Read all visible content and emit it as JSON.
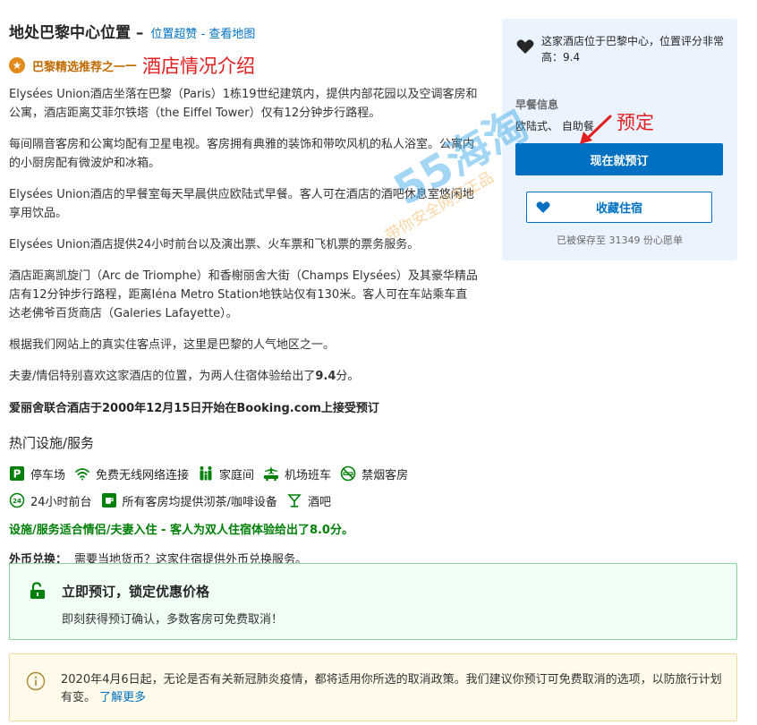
{
  "header": {
    "title": "地处巴黎中心位置 –",
    "link_location": "位置超赞",
    "separator": " - ",
    "link_map": "查看地图"
  },
  "recommendation": {
    "label": "巴黎精选推荐之一",
    "annotation": "酒店情况介绍"
  },
  "description": [
    "Elysées Union酒店坐落在巴黎（Paris）1栋19世纪建筑内，提供内部花园以及空调客房和公寓，酒店距离艾菲尔铁塔（the Eiffel Tower）仅有12分钟步行路程。",
    "每间隔音客房和公寓均配有卫星电视。客房拥有典雅的装饰和带吹风机的私人浴室。公寓内的小厨房配有微波炉和冰箱。",
    "Elysées Union酒店的早餐室每天早晨供应欧陆式早餐。客人可在酒店的酒吧休息室悠闲地享用饮品。",
    "Elysées Union酒店提供24小时前台以及演出票、火车票和飞机票的票务服务。",
    "酒店距离凯旋门（Arc de Triomphe）和香榭丽舍大街（Champs Elysées）及其豪华精品店有12分钟步行路程，距离Iéna Metro Station地铁站仅有130米。客人可在车站乘车直达老佛爷百货商店（Galeries Lafayette）。",
    "根据我们网站上的真实住客点评，这里是巴黎的人气地区之一。"
  ],
  "couple_rating_text": {
    "prefix": "夫妻/情侣特别喜欢这家酒店的位置，为两人住宿体验给出了",
    "score": "9.4",
    "suffix": "分。"
  },
  "founded": "爱丽舍联合酒店于2000年12月15日开始在Booking.com上接受预订",
  "facilities": {
    "heading": "热门设施/服务",
    "row1": [
      "停车场",
      "免费无线网络连接",
      "家庭间",
      "机场班车",
      "禁烟客房"
    ],
    "row2": [
      "24小时前台",
      "所有客房均提供沏茶/咖啡设备",
      "酒吧"
    ],
    "icon_names": [
      "parking-icon",
      "wifi-icon",
      "family-icon",
      "shuttle-icon",
      "no-smoking-icon",
      "24h-icon",
      "coffee-icon",
      "bar-icon"
    ]
  },
  "couple_suitable": "设施/服务适合情侣/夫妻入住 - 客人为双人住宿体验给出了8.0分。",
  "currency": {
    "label": "外币兑换：",
    "text": "需要当地货币？这家住宿提供外币兑换服务。"
  },
  "book_now_box": {
    "title": "立即预订，锁定优惠价格",
    "subtitle": "即刻获得预订确认，多数客房可免费取消！"
  },
  "notice": {
    "text": "2020年4月6日起，无论是否有关新冠肺炎疫情，都将适用你所选的取消政策。我们建议你预订可免费取消的选项，以防旅行计划有变。",
    "link": "了解更多"
  },
  "sidebar": {
    "location_text": "这家酒店位于巴黎中心，位置评分非常高：9.4",
    "breakfast_label": "早餐信息",
    "breakfast_value": "欧陆式、 自助餐",
    "annotation": "预定",
    "reserve_button": "现在就预订",
    "save_button": "收藏住宿",
    "saved_count": "已被保存至 31349 份心愿单"
  },
  "watermark": {
    "brand": "55海淘",
    "slogan": "带你安全网买正品"
  },
  "colors": {
    "primary_blue": "#0071c2",
    "green": "#008009",
    "annotation_red": "#e02020",
    "sidebar_bg": "#ebf3ff"
  }
}
